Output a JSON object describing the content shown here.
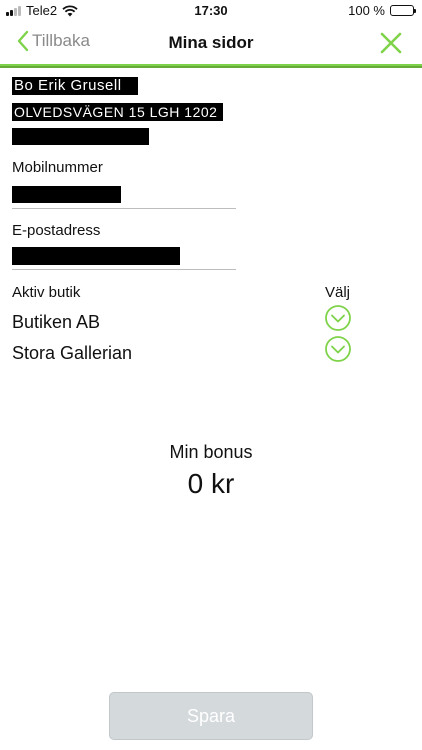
{
  "status_bar": {
    "carrier": "Tele2",
    "time": "17:30",
    "battery_percent": "100 %",
    "battery_level": 1.0
  },
  "nav": {
    "back_label": "Tillbaka",
    "title": "Mina sidor"
  },
  "profile": {
    "name": "Bo Erik Grusell",
    "address": "OLVEDSVÄGEN 15 LGH 1202"
  },
  "fields": {
    "mobile_label": "Mobilnummer",
    "email_label": "E-postadress"
  },
  "stores": {
    "active_header": "Aktiv butik",
    "select_header": "Välj",
    "items": [
      {
        "label": "Butiken AB"
      },
      {
        "label": "Stora Gallerian"
      }
    ]
  },
  "bonus": {
    "title": "Min bonus",
    "value": "0 kr"
  },
  "save_label": "Spara",
  "colors": {
    "accent": "#7fd34a",
    "accent_dark": "#67aa38",
    "back_gray": "#8a8a8a",
    "button_disabled": "#d4d9dc"
  }
}
